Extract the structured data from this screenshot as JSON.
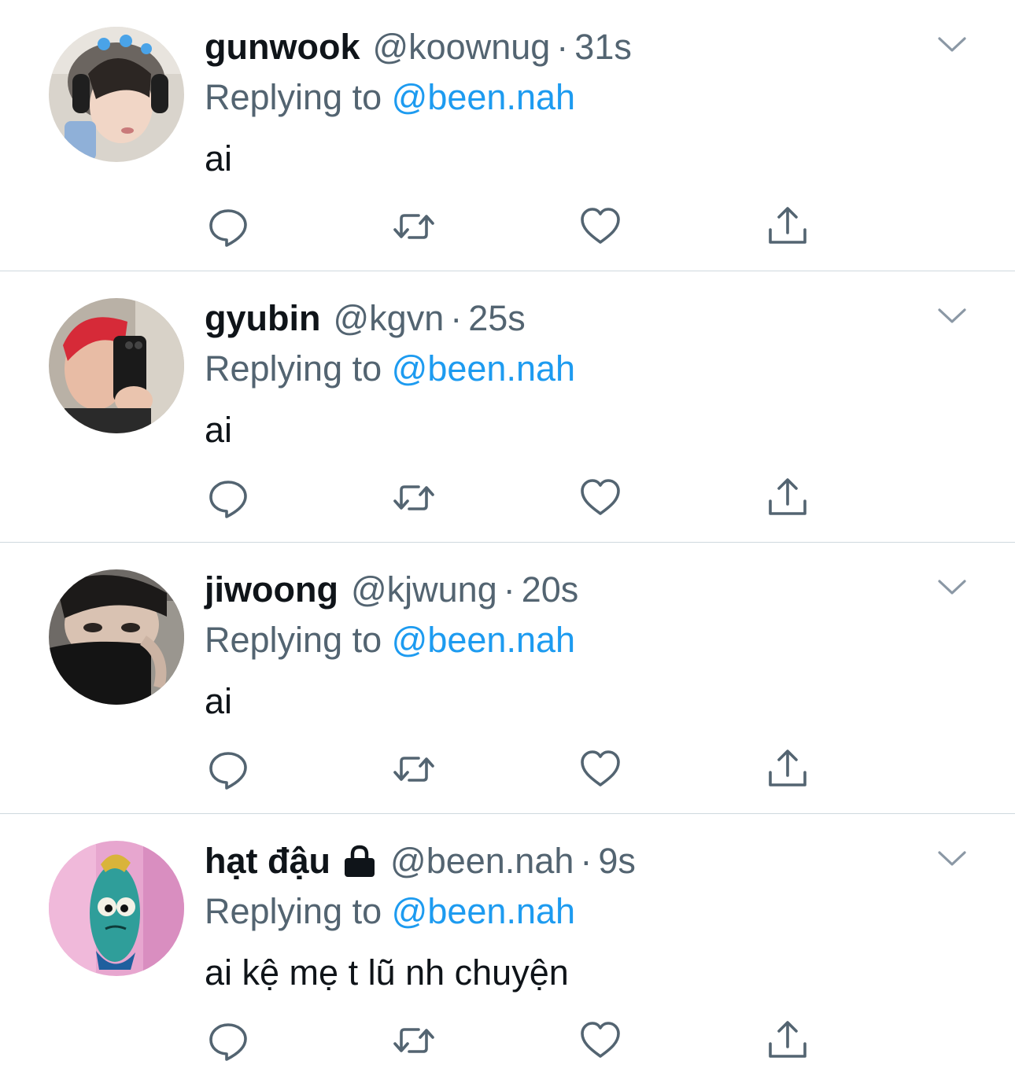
{
  "colors": {
    "text_primary": "#0f1419",
    "text_secondary": "#536471",
    "link": "#1d9bf0",
    "divider": "#cfd9de",
    "icon": "#536471"
  },
  "icons": {
    "reply": "reply-icon",
    "retweet": "retweet-icon",
    "like": "heart-icon",
    "share": "share-icon",
    "menu": "chevron-down-icon",
    "lock": "lock-icon"
  },
  "tweets": [
    {
      "display_name": "gunwook",
      "handle": "@koownug",
      "separator": "·",
      "time": "31s",
      "reply_prefix": "Replying to",
      "reply_target": "@been.nah",
      "text": "ai"
    },
    {
      "display_name": "gyubin",
      "handle": "@kgvn",
      "separator": "·",
      "time": "25s",
      "reply_prefix": "Replying to",
      "reply_target": "@been.nah",
      "text": "ai"
    },
    {
      "display_name": "jiwoong",
      "handle": "@kjwung",
      "separator": "·",
      "time": "20s",
      "reply_prefix": "Replying to",
      "reply_target": "@been.nah",
      "text": "ai"
    },
    {
      "display_name": "hạt đậu",
      "protected": true,
      "handle": "@been.nah",
      "separator": "·",
      "time": "9s",
      "reply_prefix": "Replying to",
      "reply_target": "@been.nah",
      "text": "ai kệ mẹ t lũ nh chuyện"
    }
  ]
}
